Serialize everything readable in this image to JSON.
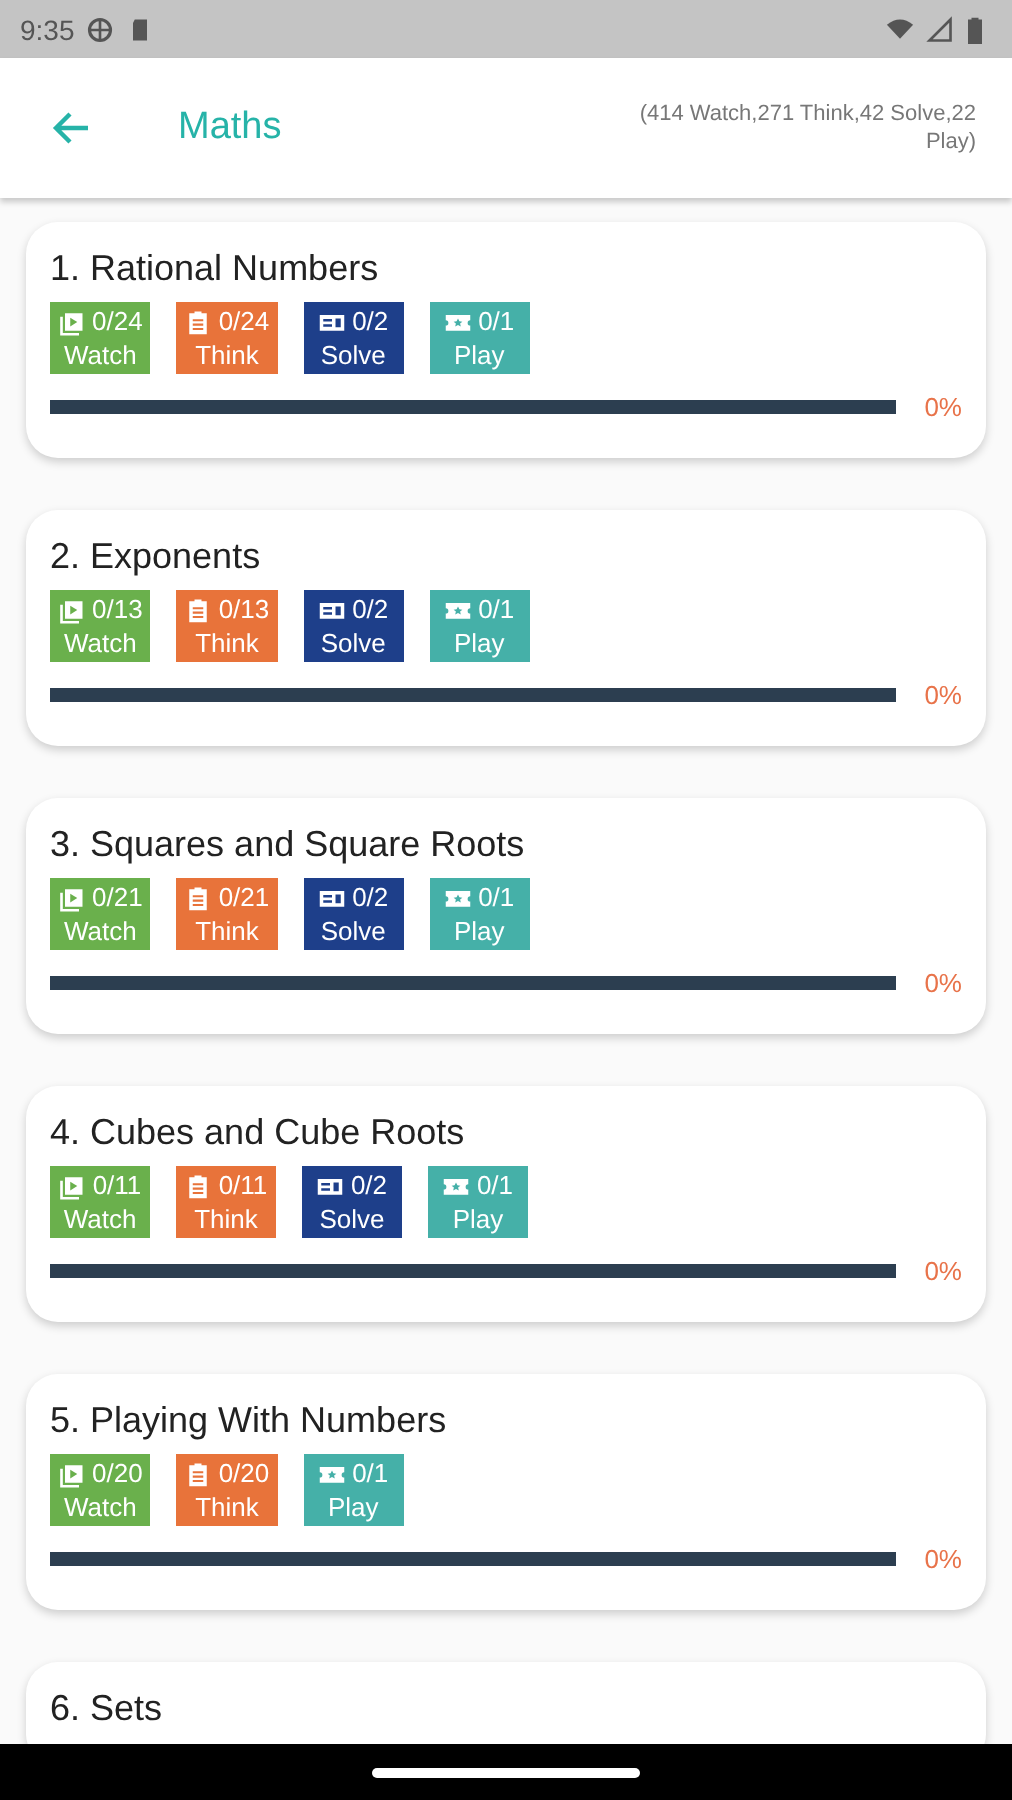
{
  "status_bar": {
    "time": "9:35"
  },
  "header": {
    "title": "Maths",
    "summary": "(414 Watch,271 Think,42 Solve,22 Play)"
  },
  "chapters": [
    {
      "title": "1. Rational Numbers",
      "badges": [
        {
          "kind": "watch",
          "count": "0/24",
          "label": "Watch"
        },
        {
          "kind": "think",
          "count": "0/24",
          "label": "Think"
        },
        {
          "kind": "solve",
          "count": "0/2",
          "label": "Solve"
        },
        {
          "kind": "play",
          "count": "0/1",
          "label": "Play"
        }
      ],
      "level": 0,
      "percent": "0%"
    },
    {
      "title": "2. Exponents",
      "badges": [
        {
          "kind": "watch",
          "count": "0/13",
          "label": "Watch"
        },
        {
          "kind": "think",
          "count": "0/13",
          "label": "Think"
        },
        {
          "kind": "solve",
          "count": "0/2",
          "label": "Solve"
        },
        {
          "kind": "play",
          "count": "0/1",
          "label": "Play"
        }
      ],
      "level": 0,
      "percent": "0%"
    },
    {
      "title": "3. Squares and Square Roots",
      "badges": [
        {
          "kind": "watch",
          "count": "0/21",
          "label": "Watch"
        },
        {
          "kind": "think",
          "count": "0/21",
          "label": "Think"
        },
        {
          "kind": "solve",
          "count": "0/2",
          "label": "Solve"
        },
        {
          "kind": "play",
          "count": "0/1",
          "label": "Play"
        }
      ],
      "level": 0,
      "percent": "0%"
    },
    {
      "title": "4. Cubes and Cube Roots",
      "badges": [
        {
          "kind": "watch",
          "count": "0/11",
          "label": "Watch"
        },
        {
          "kind": "think",
          "count": "0/11",
          "label": "Think"
        },
        {
          "kind": "solve",
          "count": "0/2",
          "label": "Solve"
        },
        {
          "kind": "play",
          "count": "0/1",
          "label": "Play"
        }
      ],
      "level": 0,
      "percent": "0%"
    },
    {
      "title": "5. Playing With Numbers",
      "badges": [
        {
          "kind": "watch",
          "count": "0/20",
          "label": "Watch"
        },
        {
          "kind": "think",
          "count": "0/20",
          "label": "Think"
        },
        {
          "kind": "play",
          "count": "0/1",
          "label": "Play"
        }
      ],
      "level": 0,
      "percent": "0%"
    },
    {
      "title": "6. Sets"
    }
  ]
}
